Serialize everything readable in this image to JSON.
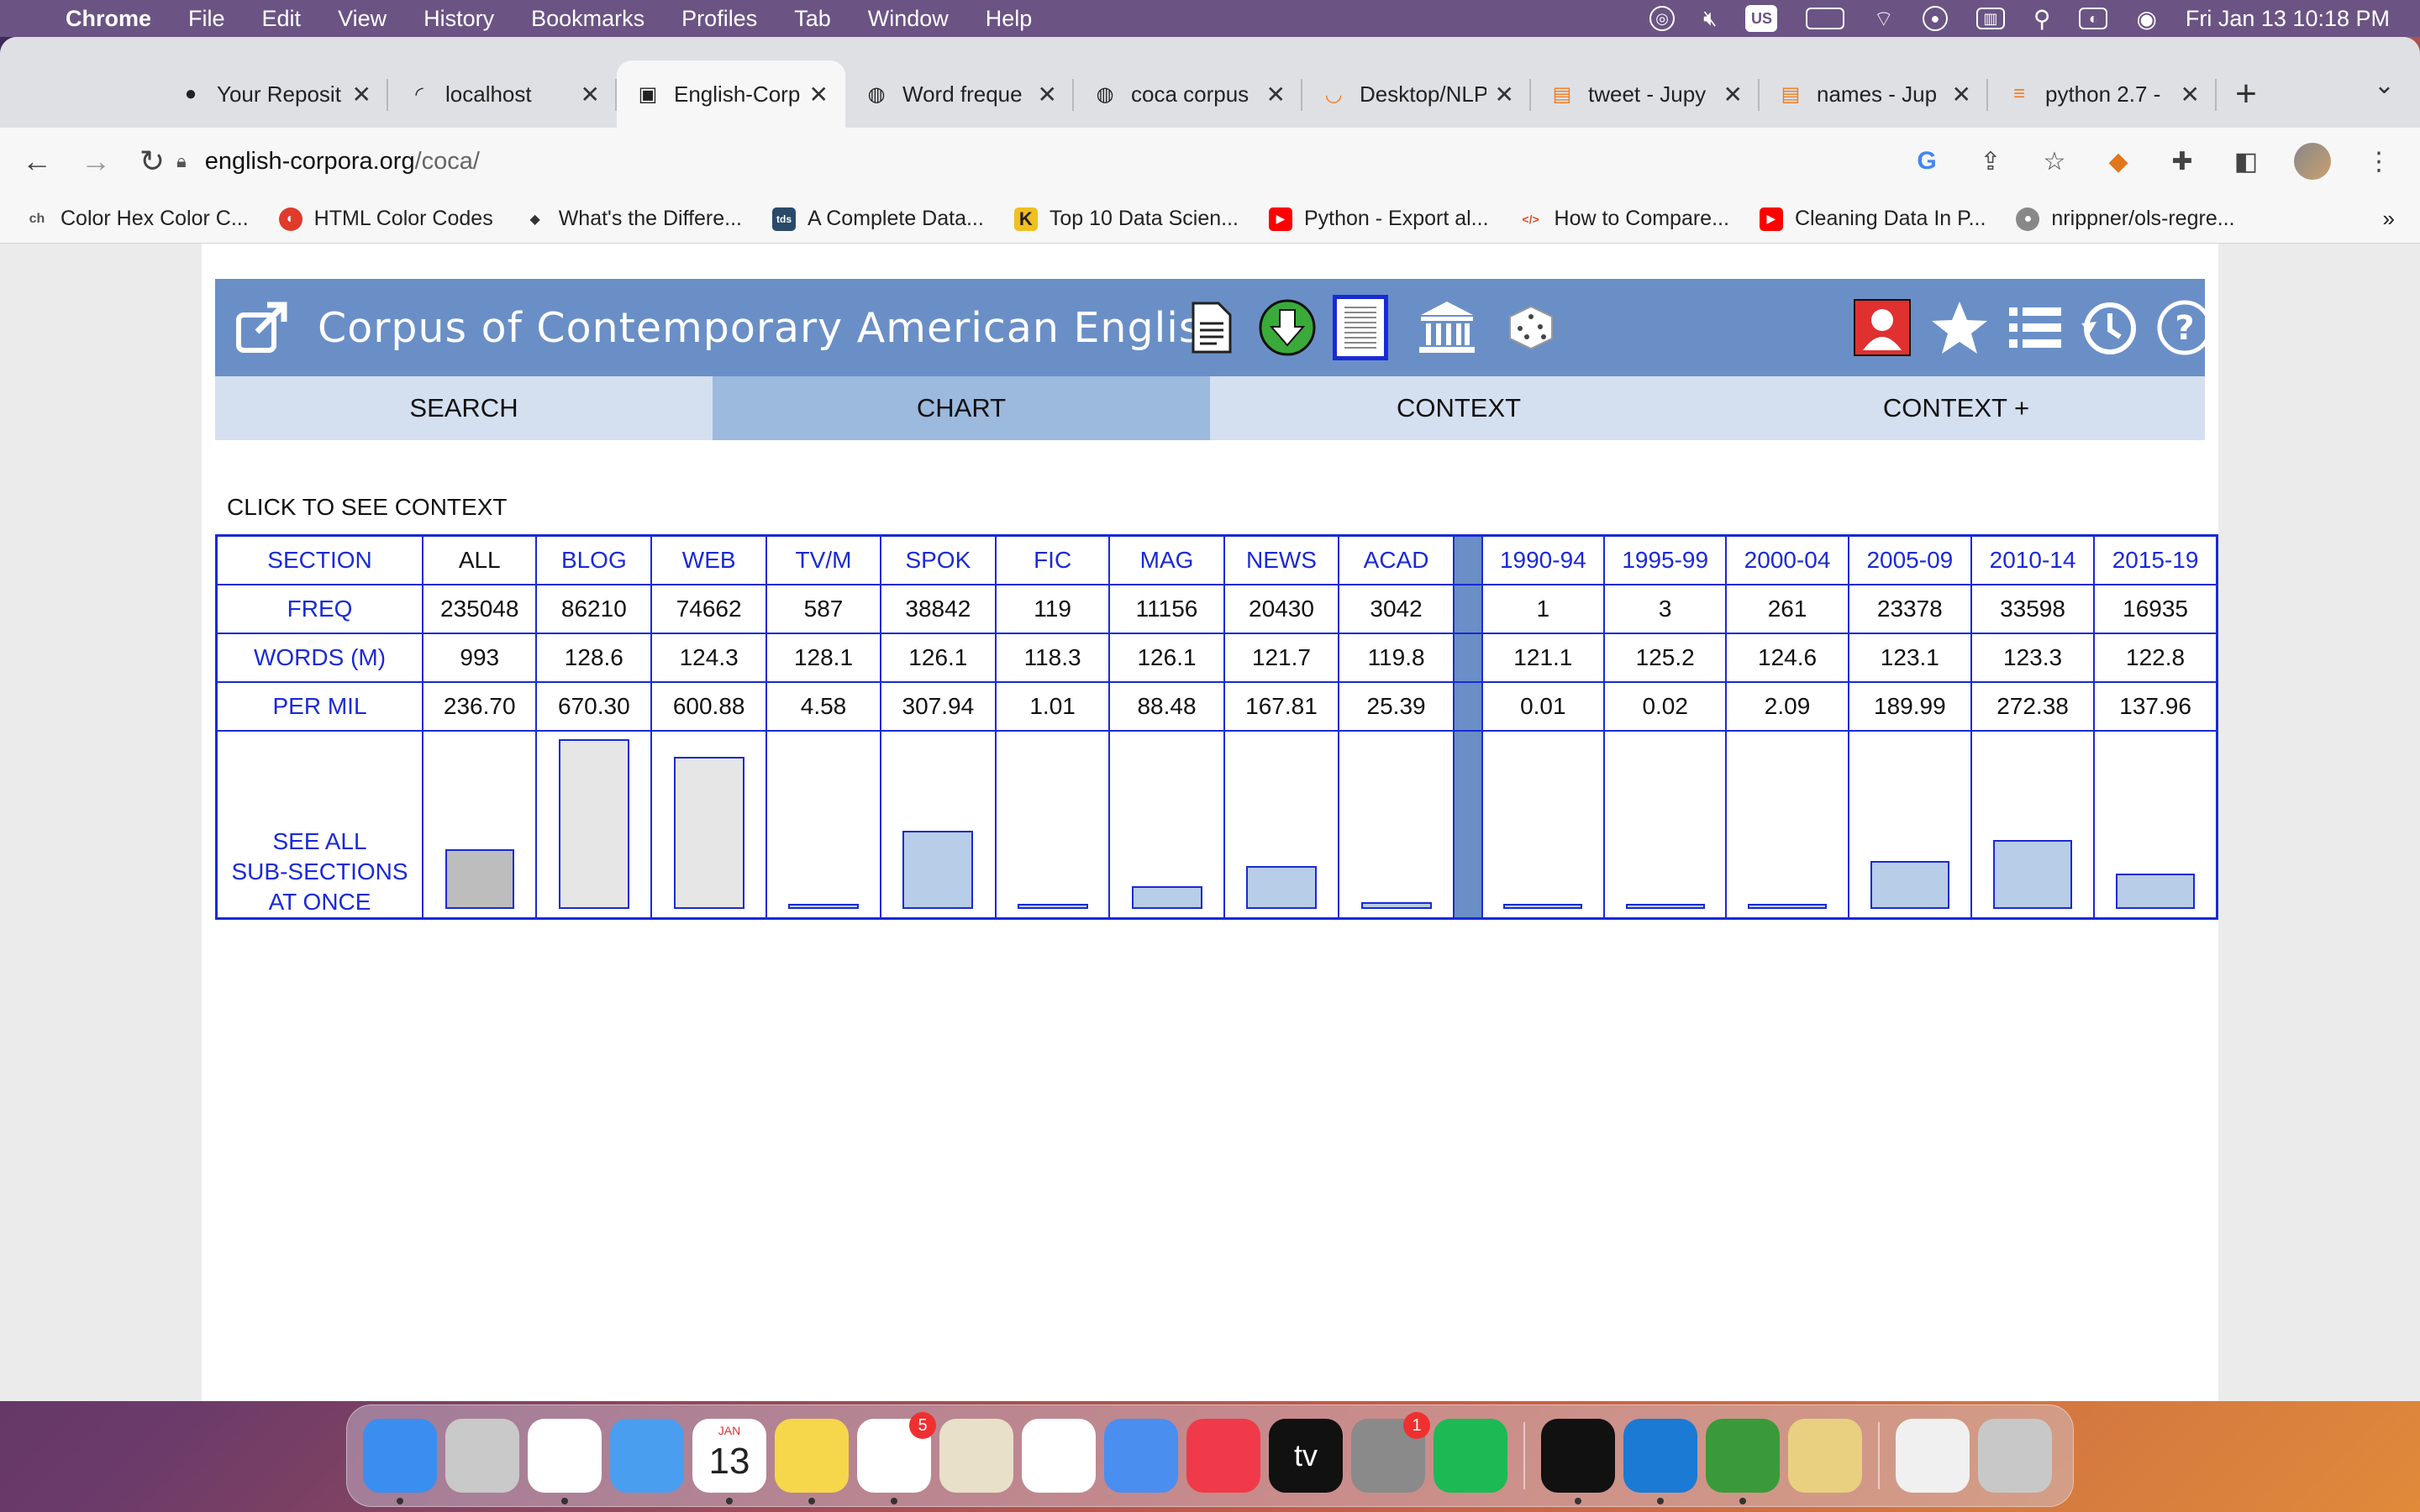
{
  "menubar": {
    "app_name": "Chrome",
    "items": [
      "File",
      "Edit",
      "View",
      "History",
      "Bookmarks",
      "Profiles",
      "Tab",
      "Window",
      "Help"
    ],
    "input_source": "US",
    "clock": "Fri Jan 13  10:18 PM"
  },
  "tabs": [
    {
      "label": "Your Reposit",
      "icon": "github-icon"
    },
    {
      "label": "localhost",
      "icon": "loading-icon"
    },
    {
      "label": "English-Corp",
      "icon": "page-icon",
      "active": true
    },
    {
      "label": "Word freque",
      "icon": "globe-icon"
    },
    {
      "label": "coca corpus",
      "icon": "globe-icon"
    },
    {
      "label": "Desktop/NLP",
      "icon": "jupyter-icon"
    },
    {
      "label": "tweet - Jupy",
      "icon": "notebook-icon"
    },
    {
      "label": "names - Jup",
      "icon": "notebook-icon"
    },
    {
      "label": "python 2.7 -",
      "icon": "stackoverflow-icon"
    }
  ],
  "address": {
    "host": "english-corpora.org",
    "path": "/coca/"
  },
  "bookmarks": [
    {
      "label": "Color Hex Color C...",
      "icon": "ch",
      "color": "#f7f7f8"
    },
    {
      "label": "HTML Color Codes",
      "icon": "",
      "color": "#e03a2a"
    },
    {
      "label": "What's the Differe...",
      "icon": "",
      "color": "#333333"
    },
    {
      "label": "A Complete Data...",
      "icon": "tds",
      "color": "#2a4a6a"
    },
    {
      "label": "Top 10 Data Scien...",
      "icon": "K",
      "color": "#f7f7f8"
    },
    {
      "label": "Python - Export al...",
      "icon": "▶",
      "color": "#ff0000"
    },
    {
      "label": "How to Compare...",
      "icon": "</>",
      "color": "#f7f7f8"
    },
    {
      "label": "Cleaning Data In P...",
      "icon": "▶",
      "color": "#ff0000"
    },
    {
      "label": "nrippner/ols-regre...",
      "icon": "",
      "color": "#888888"
    }
  ],
  "bookmarks_more": "»",
  "coca": {
    "title": "Corpus of Contemporary American English",
    "tabs": [
      "SEARCH",
      "CHART",
      "CONTEXT",
      "CONTEXT +"
    ],
    "active_tab": "CHART",
    "hint": "CLICK TO SEE CONTEXT",
    "table": {
      "row_labels": {
        "section": "SECTION",
        "freq": "FREQ",
        "words": "WORDS (M)",
        "permil": "PER MIL",
        "seeall": [
          "SEE ALL",
          "SUB-SECTIONS",
          "AT ONCE"
        ]
      },
      "columns": [
        {
          "name": "ALL",
          "freq": "235048",
          "words": "993",
          "permil": "236.70"
        },
        {
          "name": "BLOG",
          "freq": "86210",
          "words": "128.6",
          "permil": "670.30"
        },
        {
          "name": "WEB",
          "freq": "74662",
          "words": "124.3",
          "permil": "600.88"
        },
        {
          "name": "TV/M",
          "freq": "587",
          "words": "128.1",
          "permil": "4.58"
        },
        {
          "name": "SPOK",
          "freq": "38842",
          "words": "126.1",
          "permil": "307.94"
        },
        {
          "name": "FIC",
          "freq": "119",
          "words": "118.3",
          "permil": "1.01"
        },
        {
          "name": "MAG",
          "freq": "11156",
          "words": "126.1",
          "permil": "88.48"
        },
        {
          "name": "NEWS",
          "freq": "20430",
          "words": "121.7",
          "permil": "167.81"
        },
        {
          "name": "ACAD",
          "freq": "3042",
          "words": "119.8",
          "permil": "25.39"
        },
        {
          "name": "1990-94",
          "freq": "1",
          "words": "121.1",
          "permil": "0.01"
        },
        {
          "name": "1995-99",
          "freq": "3",
          "words": "125.2",
          "permil": "0.02"
        },
        {
          "name": "2000-04",
          "freq": "261",
          "words": "124.6",
          "permil": "2.09"
        },
        {
          "name": "2005-09",
          "freq": "23378",
          "words": "123.1",
          "permil": "189.99"
        },
        {
          "name": "2010-14",
          "freq": "33598",
          "words": "123.3",
          "permil": "272.38"
        },
        {
          "name": "2015-19",
          "freq": "16935",
          "words": "122.8",
          "permil": "137.96"
        }
      ]
    }
  },
  "chart_data": {
    "type": "bar",
    "categories": [
      "ALL",
      "BLOG",
      "WEB",
      "TV/M",
      "SPOK",
      "FIC",
      "MAG",
      "NEWS",
      "ACAD",
      "1990-94",
      "1995-99",
      "2000-04",
      "2005-09",
      "2010-14",
      "2015-19"
    ],
    "values": [
      236.7,
      670.3,
      600.88,
      4.58,
      307.94,
      1.01,
      88.48,
      167.81,
      25.39,
      0.01,
      0.02,
      2.09,
      189.99,
      272.38,
      137.96
    ],
    "ylabel": "PER MIL"
  },
  "dock": [
    {
      "name": "finder",
      "color": "#3a8ef0"
    },
    {
      "name": "launchpad",
      "color": "#c9c9c9"
    },
    {
      "name": "chrome",
      "color": "#ffffff"
    },
    {
      "name": "mail",
      "color": "#4a9ef0"
    },
    {
      "name": "calendar",
      "color": "#ffffff",
      "text": "13",
      "sub": "JAN"
    },
    {
      "name": "notes",
      "color": "#f6d64a"
    },
    {
      "name": "reminders",
      "color": "#ffffff",
      "badge": "5"
    },
    {
      "name": "preview",
      "color": "#e8e0c8"
    },
    {
      "name": "photos",
      "color": "#ffffff"
    },
    {
      "name": "keynote",
      "color": "#4a8ef0"
    },
    {
      "name": "music",
      "color": "#f03a4a"
    },
    {
      "name": "tv",
      "color": "#111111",
      "text": "tv"
    },
    {
      "name": "system-preferences",
      "color": "#8a8a8a",
      "badge": "1"
    },
    {
      "name": "spotify",
      "color": "#1db954"
    },
    {
      "name": "terminal",
      "color": "#111111"
    },
    {
      "name": "vscode",
      "color": "#1a7ad4"
    },
    {
      "name": "anaconda",
      "color": "#3a9a3a"
    },
    {
      "name": "python-launcher",
      "color": "#e8d080"
    },
    {
      "name": "text-file",
      "color": "#f0f0f0"
    },
    {
      "name": "trash",
      "color": "#c8c8c8"
    }
  ]
}
